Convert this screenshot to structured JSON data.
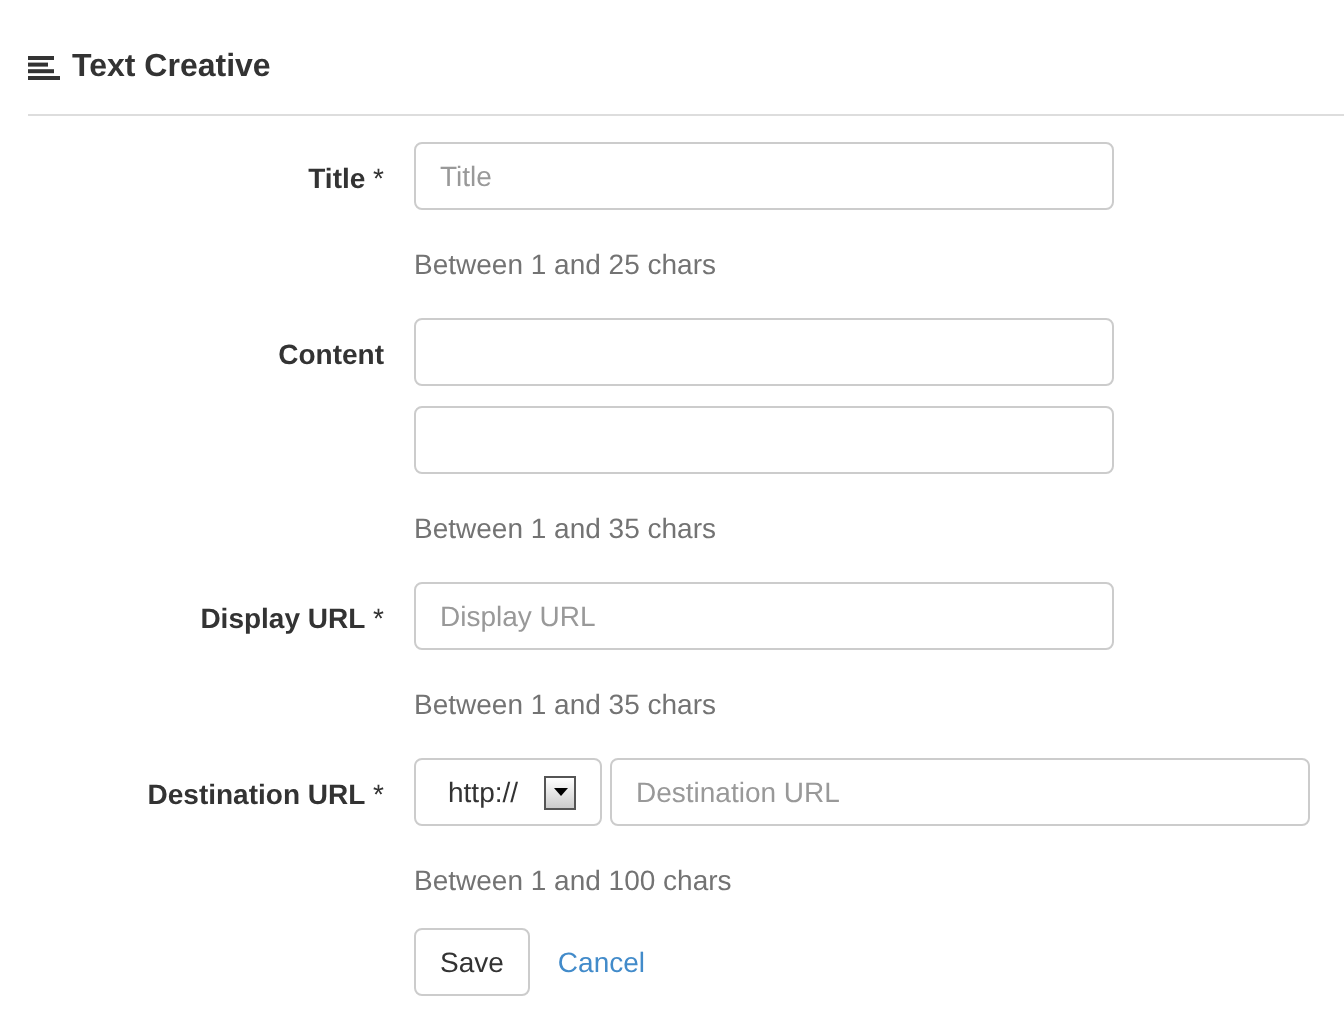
{
  "header": {
    "title": "Text Creative"
  },
  "fields": [
    {
      "kind": "text",
      "label": "**Title** *",
      "inputs": [
        {
          "kind": "text",
          "placeholder": "Title"
        }
      ],
      "help": "Between 1 and 25 chars"
    },
    {
      "kind": "text",
      "label": "**Content**",
      "inputs": [
        {
          "kind": "text"
        },
        {
          "kind": "text"
        }
      ],
      "help": "Between 1 and 35 chars"
    },
    {
      "kind": "text",
      "label": "**Display URL** *",
      "inputs": [
        {
          "kind": "text",
          "placeholder": "Display URL"
        }
      ],
      "help": "Between 1 and 35 chars"
    },
    {
      "kind": "url",
      "label": "**Destination URL** *",
      "protocol": "http://",
      "inputs": [
        {
          "kind": "text",
          "placeholder": "Destination URL"
        }
      ],
      "help": "Between 1 and 100 chars"
    }
  ],
  "actions": {
    "save": "Save",
    "cancel": "Cancel"
  }
}
